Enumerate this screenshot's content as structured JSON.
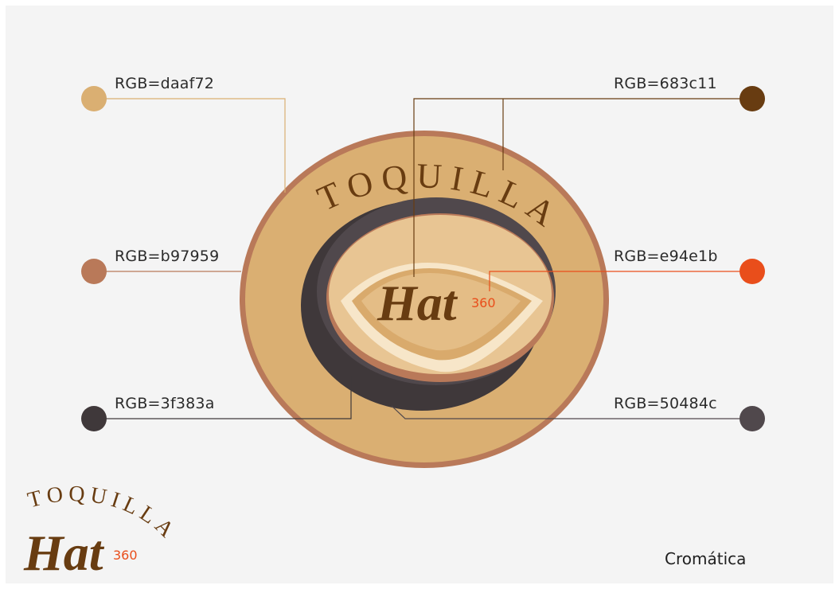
{
  "logo": {
    "arc_text": "TOQUILLA",
    "script_text": "Hat",
    "number_text": "360"
  },
  "swatches": [
    {
      "id": "daaf72",
      "label": "RGB=daaf72",
      "color": "#daaf72"
    },
    {
      "id": "b97959",
      "label": "RGB=b97959",
      "color": "#b97959"
    },
    {
      "id": "3f383a",
      "label": "RGB=3f383a",
      "color": "#3f383a"
    },
    {
      "id": "683c11",
      "label": "RGB=683c11",
      "color": "#683c11"
    },
    {
      "id": "e94e1b",
      "label": "RGB=e94e1b",
      "color": "#e94e1b"
    },
    {
      "id": "50484c",
      "label": "RGB=50484c",
      "color": "#50484c"
    }
  ],
  "footer": {
    "title": "Cromática"
  }
}
